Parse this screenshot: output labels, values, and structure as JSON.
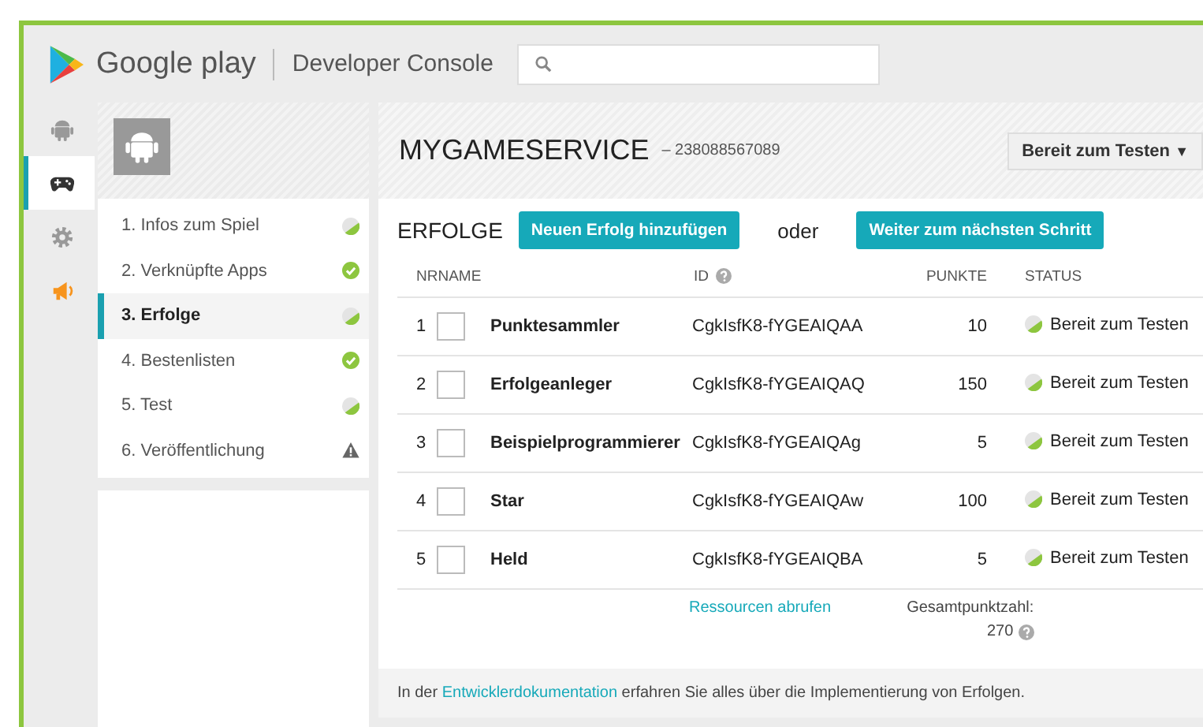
{
  "header": {
    "brand": "Google play",
    "product": "Developer Console"
  },
  "rail_items": [
    {
      "selected": false
    },
    {
      "selected": true
    },
    {
      "selected": false
    },
    {
      "selected": false
    }
  ],
  "steps": [
    {
      "label": "1. Infos zum Spiel",
      "selected": false,
      "kind": "partial"
    },
    {
      "label": "2. Verknüpfte Apps",
      "selected": false,
      "kind": "done"
    },
    {
      "label": "3. Erfolge",
      "selected": true,
      "kind": "partial"
    },
    {
      "label": "4. Bestenlisten",
      "selected": false,
      "kind": "done"
    },
    {
      "label": "5. Test",
      "selected": false,
      "kind": "partial"
    },
    {
      "label": "6. Veröffentlichung",
      "selected": false,
      "kind": "warning"
    }
  ],
  "app": {
    "title": "MYGAMESERVICE",
    "id": "– 238088567089",
    "status_button": "Bereit zum Testen",
    "status_caret": "▼"
  },
  "section": {
    "title": "ERFOLGE",
    "add_button": "Neuen Erfolg hinzufügen",
    "or": "oder",
    "next_button": "Weiter zum nächsten Schritt"
  },
  "table": {
    "columns": [
      "NR",
      "NAME",
      "ID",
      "PUNKTE",
      "STATUS"
    ],
    "rows": [
      {
        "nr": "1",
        "checked": false,
        "name": "Punktesammler",
        "id": "CgkIsfK8-fYGEAIQAA",
        "points": "10",
        "status": "Bereit zum Testen"
      },
      {
        "nr": "2",
        "checked": false,
        "name": "Erfolgeanleger",
        "id": "CgkIsfK8-fYGEAIQAQ",
        "points": "150",
        "status": "Bereit zum Testen"
      },
      {
        "nr": "3",
        "checked": false,
        "name": "Beispielprogrammierer",
        "id": "CgkIsfK8-fYGEAIQAg",
        "points": "5",
        "status": "Bereit zum Testen"
      },
      {
        "nr": "4",
        "checked": false,
        "name": "Star",
        "id": "CgkIsfK8-fYGEAIQAw",
        "points": "100",
        "status": "Bereit zum Testen"
      },
      {
        "nr": "5",
        "checked": false,
        "name": "Held",
        "id": "CgkIsfK8-fYGEAIQBA",
        "points": "5",
        "status": "Bereit zum Testen"
      }
    ],
    "resources_link": "Ressourcen abrufen",
    "total_label": "Gesamtpunktzahl:",
    "total": "270"
  },
  "footer": {
    "before": "In der ",
    "link": "Entwicklerdokumentation",
    "after": " erfahren Sie alles über die Implementierung von Erfolgen."
  }
}
